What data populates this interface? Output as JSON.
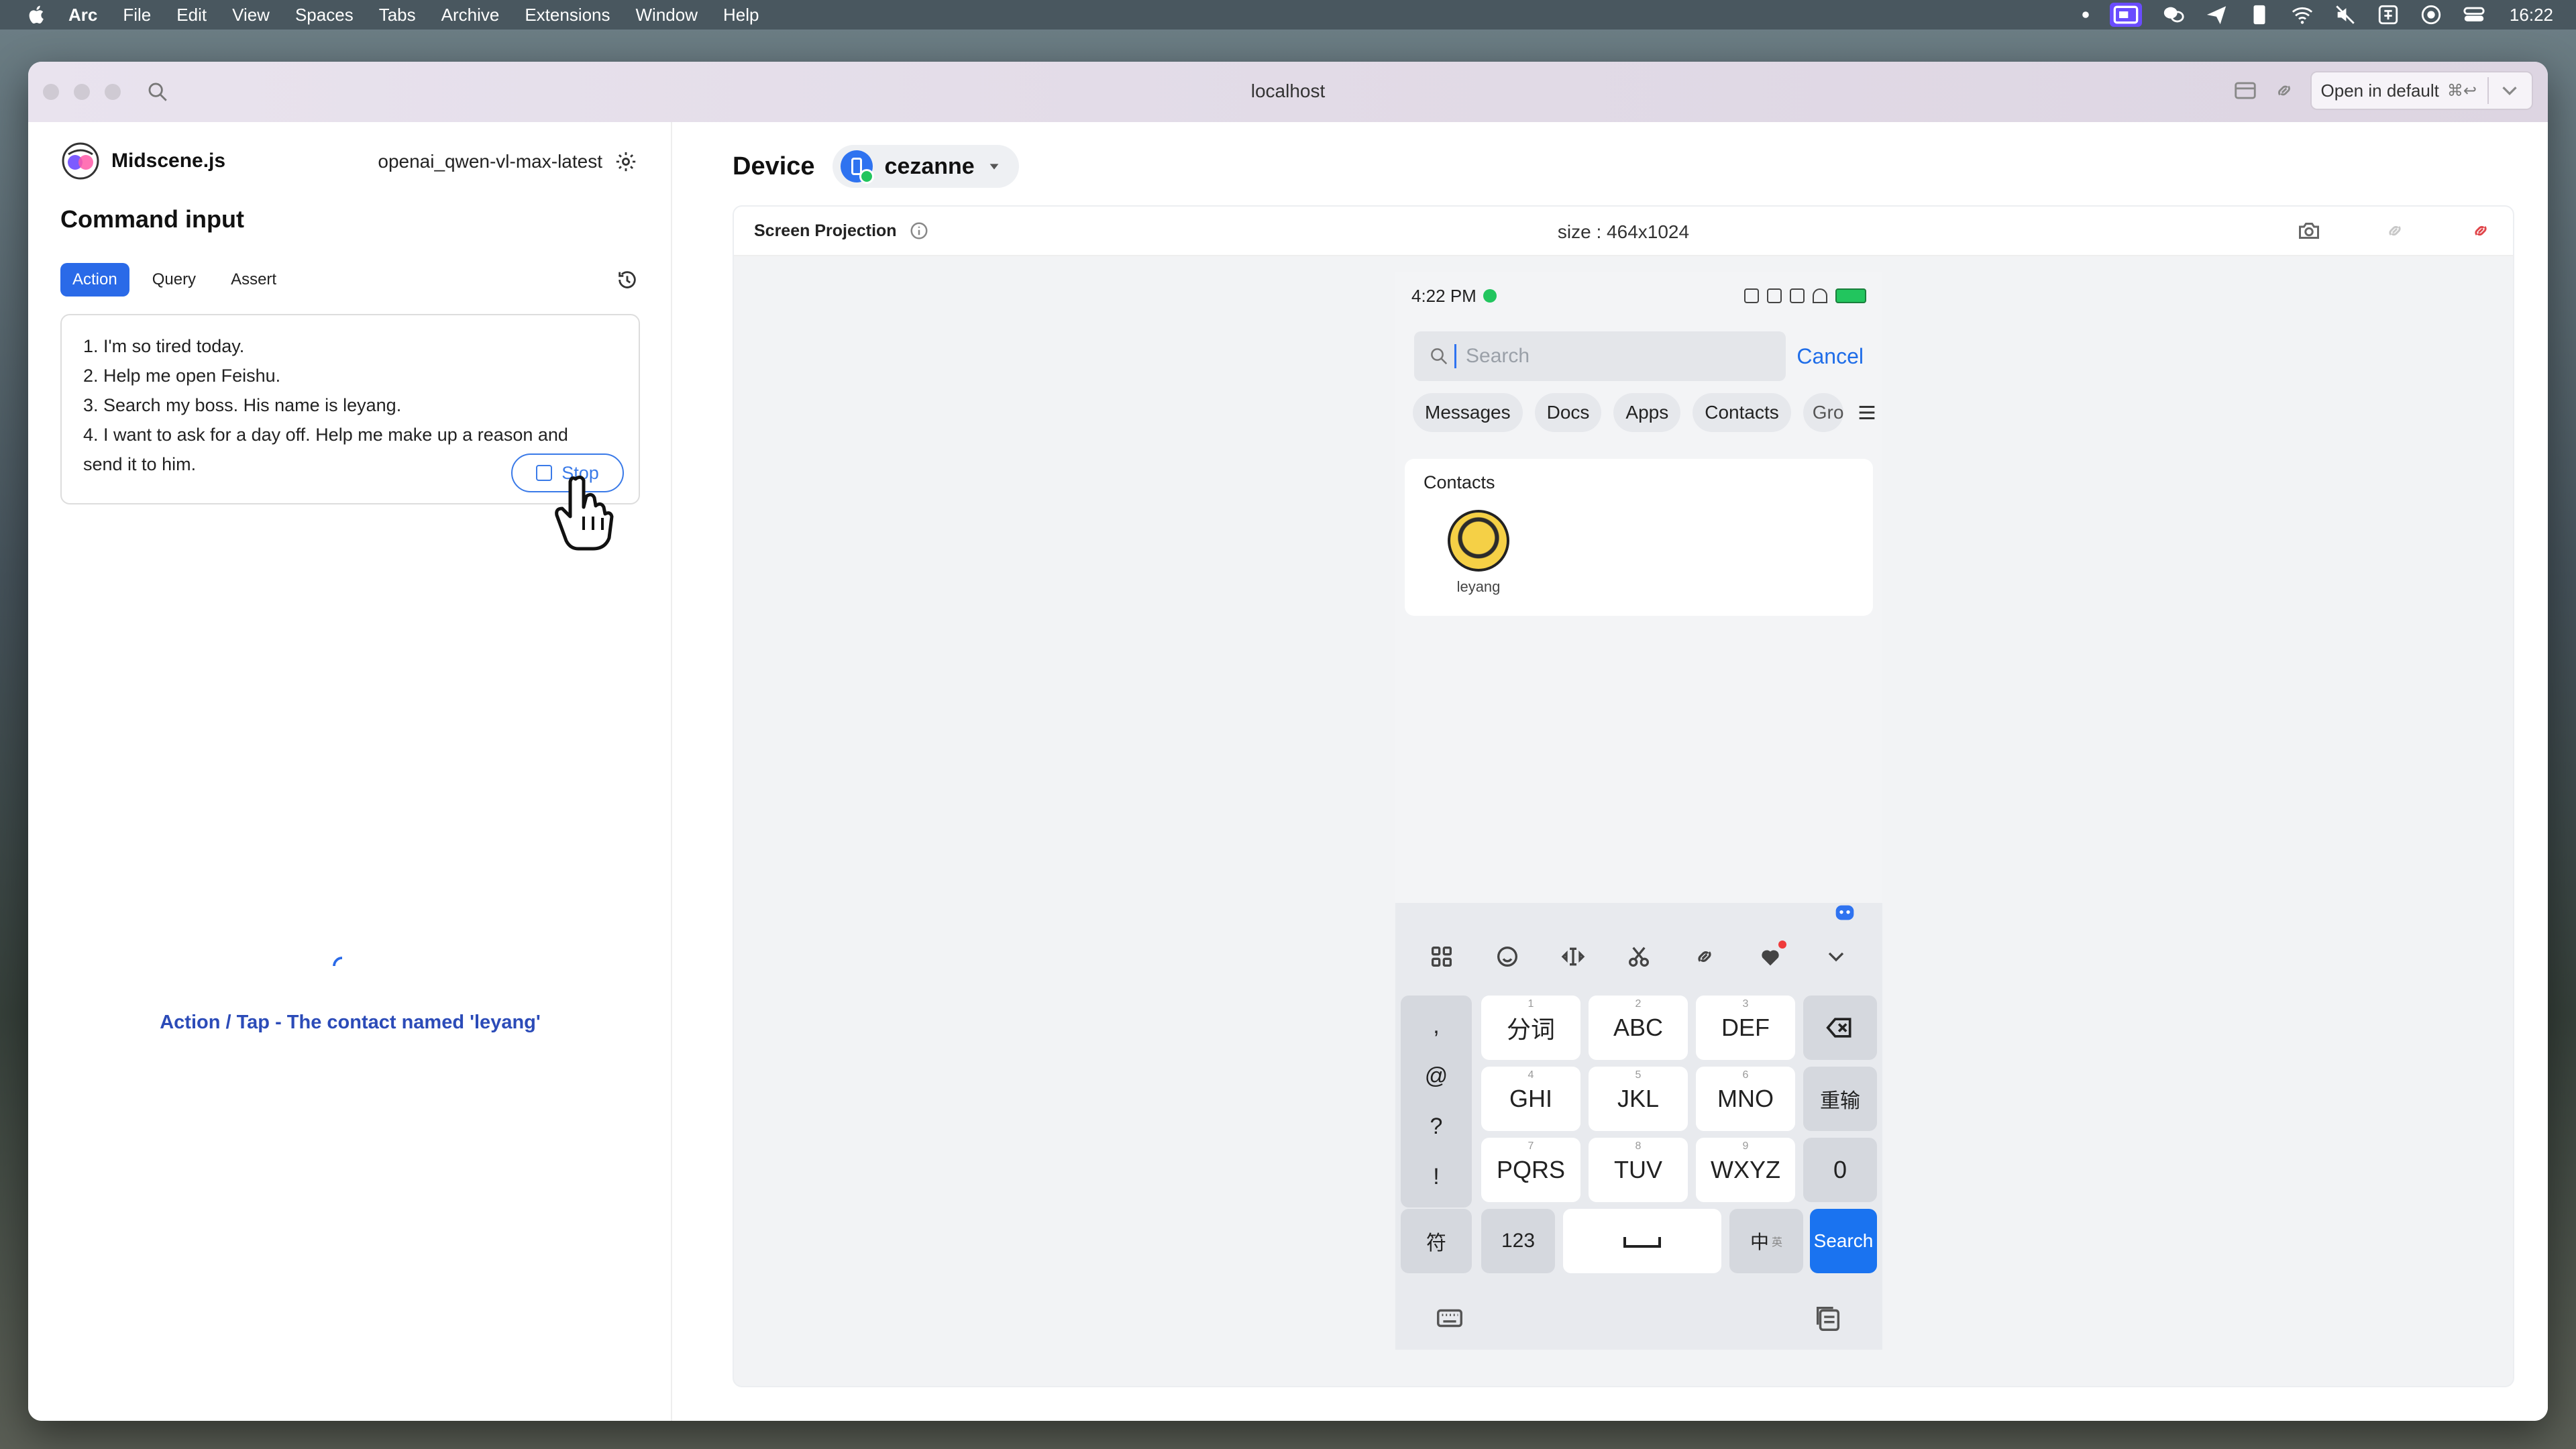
{
  "menubar": {
    "app_name": "Arc",
    "items": [
      "File",
      "Edit",
      "View",
      "Spaces",
      "Tabs",
      "Archive",
      "Extensions",
      "Window",
      "Help"
    ],
    "clock": "16:22"
  },
  "browser": {
    "url": "localhost",
    "open_default_label": "Open in default",
    "open_default_shortcut": "⌘↩"
  },
  "left_panel": {
    "brand": "Midscene.js",
    "model": "openai_qwen-vl-max-latest",
    "title": "Command input",
    "tabs": [
      {
        "label": "Action",
        "active": true
      },
      {
        "label": "Query",
        "active": false
      },
      {
        "label": "Assert",
        "active": false
      }
    ],
    "prompt_lines": [
      "1. I'm so tired today.",
      "2. Help me open Feishu.",
      "3. Search my boss. His name is leyang.",
      "4. I want to ask for a day off. Help me make up a reason and",
      "send it to him."
    ],
    "stop_label": "Stop",
    "status_text": "Action / Tap - The contact named 'leyang'"
  },
  "right_panel": {
    "device_label": "Device",
    "device_name": "cezanne",
    "projection_title": "Screen Projection",
    "size_text": "size : 464x1024"
  },
  "phone": {
    "time": "4:22 PM",
    "search_placeholder": "Search",
    "cancel": "Cancel",
    "chips": [
      "Messages",
      "Docs",
      "Apps",
      "Contacts",
      "Gro"
    ],
    "contacts_title": "Contacts",
    "contact_name": "leyang",
    "keyboard": {
      "symbols": [
        ",",
        "@",
        "?",
        "!"
      ],
      "row1": [
        {
          "num": "1",
          "label": "分词"
        },
        {
          "num": "2",
          "label": "ABC"
        },
        {
          "num": "3",
          "label": "DEF"
        }
      ],
      "row2": [
        {
          "num": "4",
          "label": "GHI"
        },
        {
          "num": "5",
          "label": "JKL"
        },
        {
          "num": "6",
          "label": "MNO"
        }
      ],
      "row3": [
        {
          "num": "7",
          "label": "PQRS"
        },
        {
          "num": "8",
          "label": "TUV"
        },
        {
          "num": "9",
          "label": "WXYZ"
        }
      ],
      "reenter": "重输",
      "zero": "0",
      "sym": "符",
      "num": "123",
      "lang": "中",
      "lang_sub": "英",
      "search": "Search"
    }
  },
  "colors": {
    "accent_blue": "#2a6ae8",
    "status_text": "#2b4bb8",
    "danger": "#e0454a"
  }
}
